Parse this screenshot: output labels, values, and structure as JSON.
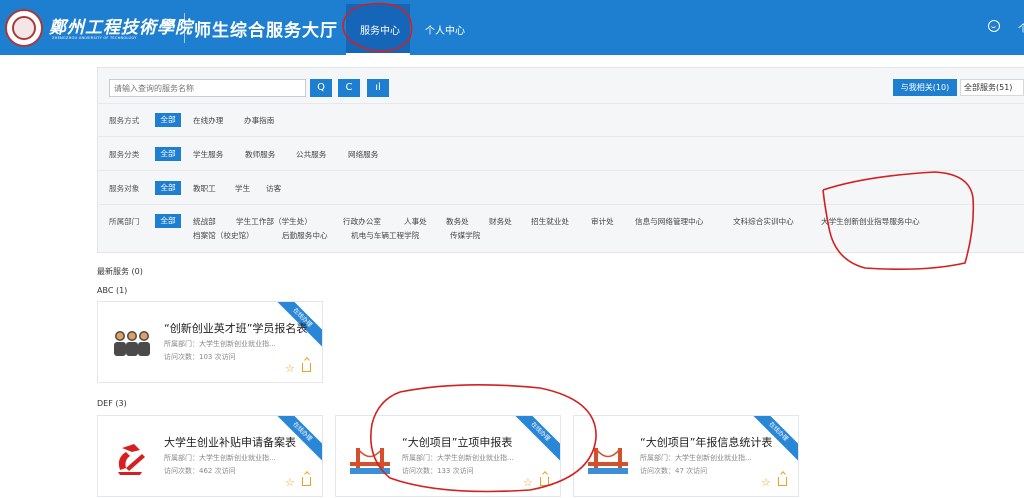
{
  "header": {
    "school_name_cn": "鄭州工程技術學院",
    "school_name_en": "ZHENGZHOU UNIVERSITY OF TECHNOLOGY",
    "portal_title": "师生综合服务大厅",
    "nav": {
      "active": "服务中心",
      "other": "个人中心"
    },
    "cut_text": "个"
  },
  "filters": {
    "search_placeholder": "请输入查询的服务名称",
    "search_btn": "Q",
    "refresh_btn": "C",
    "chart_btn": "ıl",
    "mine_tag": "与我相关(10)",
    "all_tag": "全部服务(51)",
    "rows": [
      {
        "label": "服务方式",
        "selected": "全部",
        "options": [
          "在线办理",
          "办事指南"
        ]
      },
      {
        "label": "服务分类",
        "selected": "全部",
        "options": [
          "学生服务",
          "教师服务",
          "公共服务",
          "网络服务"
        ]
      },
      {
        "label": "服务对象",
        "selected": "全部",
        "options": [
          "教职工",
          "学生",
          "访客"
        ]
      },
      {
        "label": "所属部门",
        "selected": "全部",
        "options": [
          "统战部",
          "学生工作部（学生处）",
          "行政办公室",
          "人事处",
          "教务处",
          "财务处",
          "招生就业处",
          "审计处",
          "信息与网络管理中心",
          "文科综合实训中心",
          "大学生创新创业指导服务中心"
        ],
        "options_line2": [
          "档案馆（校史馆）",
          "后勤服务中心",
          "机电与车辆工程学院",
          "传媒学院"
        ]
      }
    ]
  },
  "sections": {
    "latest": "最新服务 (0)",
    "abc": "ABC (1)",
    "def": "DEF (3)"
  },
  "cards": [
    {
      "title": "“创新创业英才班”学员报名表",
      "dept": "所属部门：大学生创新创业就业指...",
      "visits": "访问次数：103 次访问",
      "badge": "在线办理",
      "icon": "people-icon"
    },
    {
      "title": "大学生创业补贴申请备案表",
      "dept": "所属部门：大学生创新创业就业指...",
      "visits": "访问次数：462 次访问",
      "badge": "在线办理",
      "icon": "party-emblem-icon"
    },
    {
      "title": "“大创项目”立项申报表",
      "dept": "所属部门：大学生创新创业就业指...",
      "visits": "访问次数：133 次访问",
      "badge": "在线办理",
      "icon": "bridge-icon"
    },
    {
      "title": "“大创项目”年报信息统计表",
      "dept": "所属部门：大学生创新创业就业指...",
      "visits": "访问次数：47 次访问",
      "badge": "在线办理",
      "icon": "bridge-icon"
    }
  ],
  "colors": {
    "primary": "#1e7fd0",
    "accent": "#f0a020",
    "annotation": "#d42020"
  }
}
